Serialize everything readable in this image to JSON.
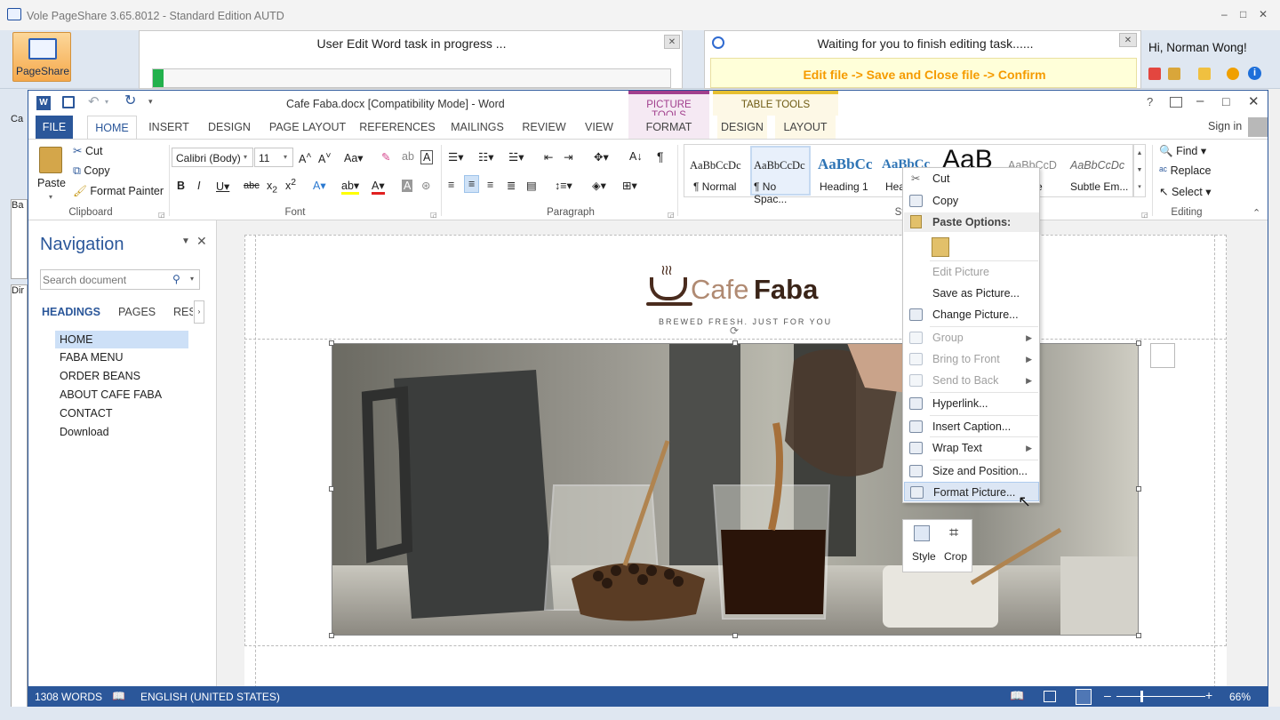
{
  "outer": {
    "title": "Vole PageShare  3.65.8012 - Standard Edition AUTD",
    "pageshare_label": "PageShare",
    "task_left": "User Edit Word task in progress ...",
    "task_right": "Waiting for you to finish editing task......",
    "instruction": "Edit file -> Save and Close file -> Confirm",
    "greeting": "Hi, Norman Wong!",
    "side_labels": [
      "Ca",
      "Ba",
      "Dir"
    ]
  },
  "word": {
    "title": "Cafe Faba.docx [Compatibility Mode] - Word",
    "sign_in": "Sign in",
    "tabs": [
      "FILE",
      "HOME",
      "INSERT",
      "DESIGN",
      "PAGE LAYOUT",
      "REFERENCES",
      "MAILINGS",
      "REVIEW",
      "VIEW"
    ],
    "picture_tools": {
      "group": "PICTURE TOOLS",
      "tab": "FORMAT"
    },
    "table_tools": {
      "group": "TABLE TOOLS",
      "tabs": [
        "DESIGN",
        "LAYOUT"
      ]
    },
    "clipboard": {
      "paste": "Paste",
      "cut": "Cut",
      "copy": "Copy",
      "format_painter": "Format Painter",
      "label": "Clipboard"
    },
    "font": {
      "name": "Calibri (Body)",
      "size": "11",
      "label": "Font"
    },
    "paragraph": {
      "label": "Paragraph"
    },
    "styles": {
      "items": [
        {
          "preview": "AaBbCcDc",
          "name": "¶ Normal"
        },
        {
          "preview": "AaBbCcDc",
          "name": "¶ No Spac..."
        },
        {
          "preview": "AaBbCc",
          "name": "Heading 1"
        },
        {
          "preview": "AaBbCc",
          "name": "Hea"
        },
        {
          "preview": "AaB",
          "name": ""
        },
        {
          "preview": "AaBbCcD",
          "name": "tle"
        },
        {
          "preview": "AaBbCcDc",
          "name": "Subtle Em..."
        }
      ],
      "label": "St"
    },
    "editing": {
      "find": "Find",
      "replace": "Replace",
      "select": "Select",
      "label": "Editing"
    }
  },
  "navigation": {
    "title": "Navigation",
    "search_placeholder": "Search document",
    "tabs": [
      "HEADINGS",
      "PAGES",
      "RESU"
    ],
    "headings": [
      "HOME",
      "FABA MENU",
      "ORDER BEANS",
      "ABOUT CAFE FABA",
      "CONTACT",
      "Download"
    ]
  },
  "document": {
    "logo_light": "Cafe",
    "logo_bold": "Faba",
    "tagline": "BREWED FRESH. JUST FOR YOU"
  },
  "context_menu": {
    "items": {
      "cut": "Cut",
      "copy": "Copy",
      "paste_options": "Paste Options:",
      "edit_picture": "Edit Picture",
      "save_as_picture": "Save as Picture...",
      "change_picture": "Change Picture...",
      "group": "Group",
      "bring_to_front": "Bring to Front",
      "send_to_back": "Send to Back",
      "hyperlink": "Hyperlink...",
      "insert_caption": "Insert Caption...",
      "wrap_text": "Wrap Text",
      "size_and_position": "Size and Position...",
      "format_picture": "Format Picture..."
    },
    "mini_toolbar": {
      "style": "Style",
      "crop": "Crop"
    }
  },
  "status": {
    "words": "1308 WORDS",
    "language": "ENGLISH (UNITED STATES)",
    "zoom": "66%",
    "zoom_level": 0.66
  },
  "colors": {
    "word_blue": "#2b579a",
    "picture_tools": "#a13f8d",
    "table_tools": "#e6bf2f",
    "instruction": "#f59b00"
  }
}
